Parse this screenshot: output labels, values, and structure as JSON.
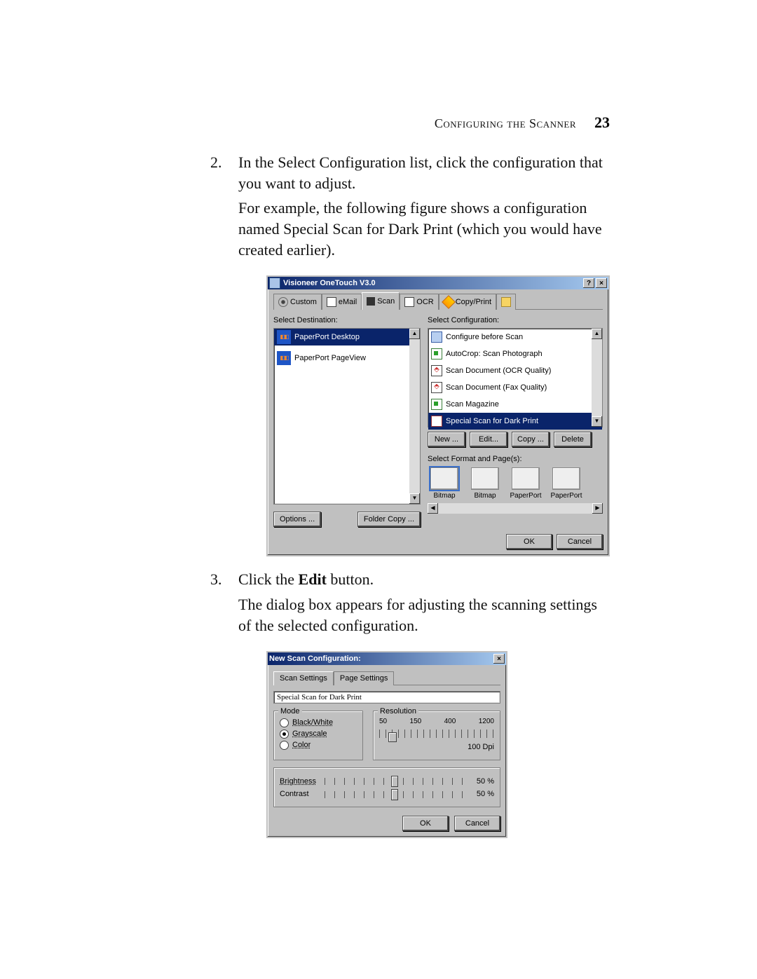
{
  "header": {
    "section": "Configuring the Scanner",
    "page": "23"
  },
  "steps": {
    "s2": {
      "num": "2.",
      "p1": "In the Select Configuration list, click the configuration that you want to adjust.",
      "p2": "For example, the following figure shows a configuration named Special Scan for Dark Print (which you would have created earlier)."
    },
    "s3": {
      "num": "3.",
      "p1a": "Click the ",
      "p1b_bold": "Edit",
      "p1c": " button.",
      "p2": "The dialog box appears for adjusting the scanning settings of the selected configuration."
    }
  },
  "dlg1": {
    "title": "Visioneer OneTouch V3.0",
    "help": "?",
    "close": "×",
    "tabs": {
      "custom": "Custom",
      "email": "eMail",
      "scan": "Scan",
      "ocr": "OCR",
      "copyprint": "Copy/Print"
    },
    "labels": {
      "selectDest": "Select Destination:",
      "selectCfg": "Select Configuration:",
      "selectFmt": "Select Format and Page(s):"
    },
    "dest": {
      "item1": "PaperPort Desktop",
      "item2": "PaperPort PageView"
    },
    "cfg": {
      "i1": "Configure before Scan",
      "i2": "AutoCrop: Scan Photograph",
      "i3": "Scan Document (OCR Quality)",
      "i4": "Scan Document (Fax Quality)",
      "i5": "Scan Magazine",
      "i6": "Special Scan for Dark Print"
    },
    "cfgbtn": {
      "newb": "New ...",
      "editb": "Edit...",
      "copyb": "Copy ...",
      "delb": "Delete"
    },
    "fmt": {
      "f1": "Bitmap",
      "f2": "Bitmap",
      "f3": "PaperPort",
      "f4": "PaperPort"
    },
    "underL": {
      "options": "Options ...",
      "folder": "Folder Copy ..."
    },
    "ok": "OK",
    "cancel": "Cancel",
    "arrow": {
      "up": "▲",
      "down": "▼",
      "left": "◀",
      "right": "▶"
    }
  },
  "dlg2": {
    "title": "New Scan Configuration:",
    "close": "×",
    "tabs": {
      "scan": "Scan Settings",
      "page": "Page Settings"
    },
    "name": "Special Scan for Dark Print",
    "mode": {
      "legend": "Mode",
      "bw": "Black/White",
      "gs": "Grayscale",
      "col": "Color"
    },
    "res": {
      "legend": "Resolution",
      "t50": "50",
      "t150": "150",
      "t400": "400",
      "t1200": "1200",
      "val": "100 Dpi"
    },
    "bc": {
      "brightness": "Brightness",
      "contrast": "Contrast",
      "bval": "50 %",
      "cval": "50 %"
    },
    "ok": "OK",
    "cancel": "Cancel"
  }
}
